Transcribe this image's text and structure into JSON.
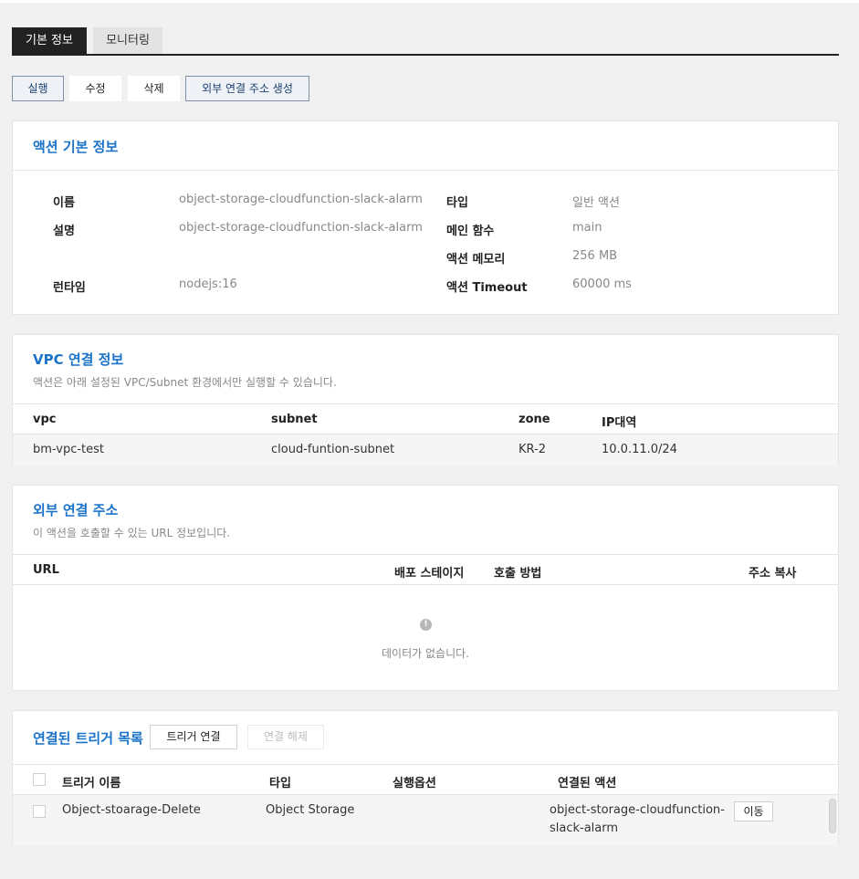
{
  "tabs": {
    "basic": "기본 정보",
    "monitoring": "모니터링"
  },
  "actions": {
    "run": "실행",
    "edit": "수정",
    "delete": "삭제",
    "create_url": "외부 연결 주소 생성"
  },
  "action_info": {
    "title": "액션 기본 정보",
    "name_label": "이름",
    "name_value": "object-storage-cloudfunction-slack-alarm",
    "desc_label": "설명",
    "desc_value": "object-storage-cloudfunction-slack-alarm",
    "runtime_label": "런타임",
    "runtime_value": "nodejs:16",
    "type_label": "타입",
    "type_value": "일반 액션",
    "main_label": "메인 함수",
    "main_value": "main",
    "memory_label": "액션 메모리",
    "memory_value": "256 MB",
    "timeout_label": "액션 Timeout",
    "timeout_value": "60000 ms"
  },
  "vpc": {
    "title": "VPC 연결 정보",
    "desc": "액션은 아래 설정된 VPC/Subnet 환경에서만 실행할 수 있습니다.",
    "headers": {
      "vpc": "vpc",
      "subnet": "subnet",
      "zone": "zone",
      "ip": "IP대역"
    },
    "row": {
      "vpc": "bm-vpc-test",
      "subnet": "cloud-funtion-subnet",
      "zone": "KR-2",
      "ip": "10.0.11.0/24"
    }
  },
  "external_url": {
    "title": "외부 연결 주소",
    "desc": "이 액션을 호출할 수 있는 URL 정보입니다.",
    "headers": {
      "url": "URL",
      "stage": "배포 스테이지",
      "method": "호출 방법",
      "copy": "주소 복사"
    },
    "empty_text": "데이터가 없습니다."
  },
  "triggers": {
    "title": "연결된 트리거 목록",
    "connect_label": "트리거 연결",
    "disconnect_label": "연결 해제",
    "headers": {
      "name": "트리거 이름",
      "type": "타입",
      "option": "실행옵션",
      "action": "연결된 액션"
    },
    "row": {
      "name": "Object-stoarage-Delete",
      "type": "Object Storage",
      "action_line1": "object-storage-cloudfunction-",
      "action_line2": "slack-alarm",
      "move_label": "이동"
    }
  }
}
